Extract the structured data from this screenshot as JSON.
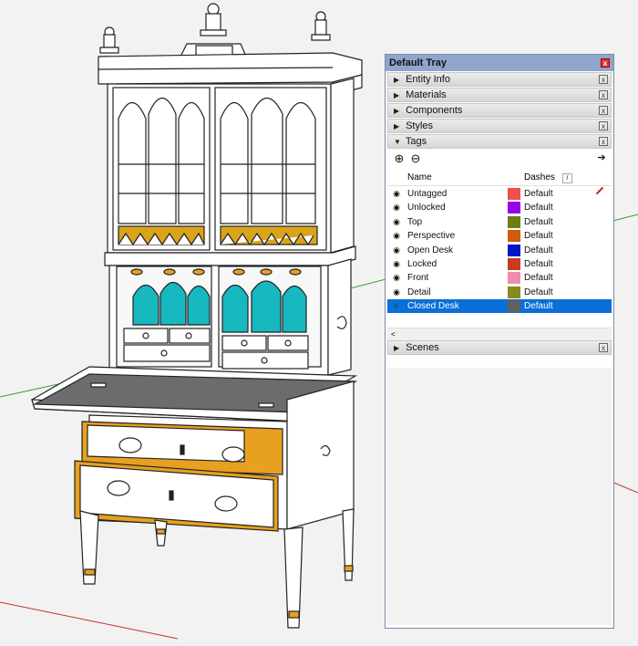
{
  "tray": {
    "title": "Default Tray",
    "close": "x",
    "panels": [
      {
        "label": "Entity Info",
        "arrow": "▶"
      },
      {
        "label": "Materials",
        "arrow": "▶"
      },
      {
        "label": "Components",
        "arrow": "▶"
      },
      {
        "label": "Styles",
        "arrow": "▶"
      },
      {
        "label": "Tags",
        "arrow": "▼"
      }
    ],
    "scenes": {
      "label": "Scenes",
      "arrow": "▶"
    }
  },
  "tags": {
    "add_icon": "⊕",
    "remove_icon": "⊖",
    "details_icon": "➔",
    "col_name": "Name",
    "col_dashes": "Dashes",
    "active_icon": "pencil-icon",
    "rows": [
      {
        "name": "Untagged",
        "color": "#f05050",
        "dashes": "Default",
        "visible": "◉"
      },
      {
        "name": "Unlocked",
        "color": "#9a00e6",
        "dashes": "Default",
        "visible": "◉"
      },
      {
        "name": "Top",
        "color": "#6e7d12",
        "dashes": "Default",
        "visible": "◉"
      },
      {
        "name": "Perspective",
        "color": "#d05a10",
        "dashes": "Default",
        "visible": "◉"
      },
      {
        "name": "Open Desk",
        "color": "#0018c8",
        "dashes": "Default",
        "visible": "◉"
      },
      {
        "name": "Locked",
        "color": "#c83c1c",
        "dashes": "Default",
        "visible": "◉"
      },
      {
        "name": "Front",
        "color": "#f08cb0",
        "dashes": "Default",
        "visible": "◉"
      },
      {
        "name": "Detail",
        "color": "#8a8a1c",
        "dashes": "Default",
        "visible": "◉"
      },
      {
        "name": "Closed Desk",
        "color": "#606060",
        "dashes": "Default",
        "visible": "○",
        "selected": true
      }
    ],
    "scroll_left": "<"
  },
  "model": {
    "description_icon": "secretary-desk-model"
  }
}
